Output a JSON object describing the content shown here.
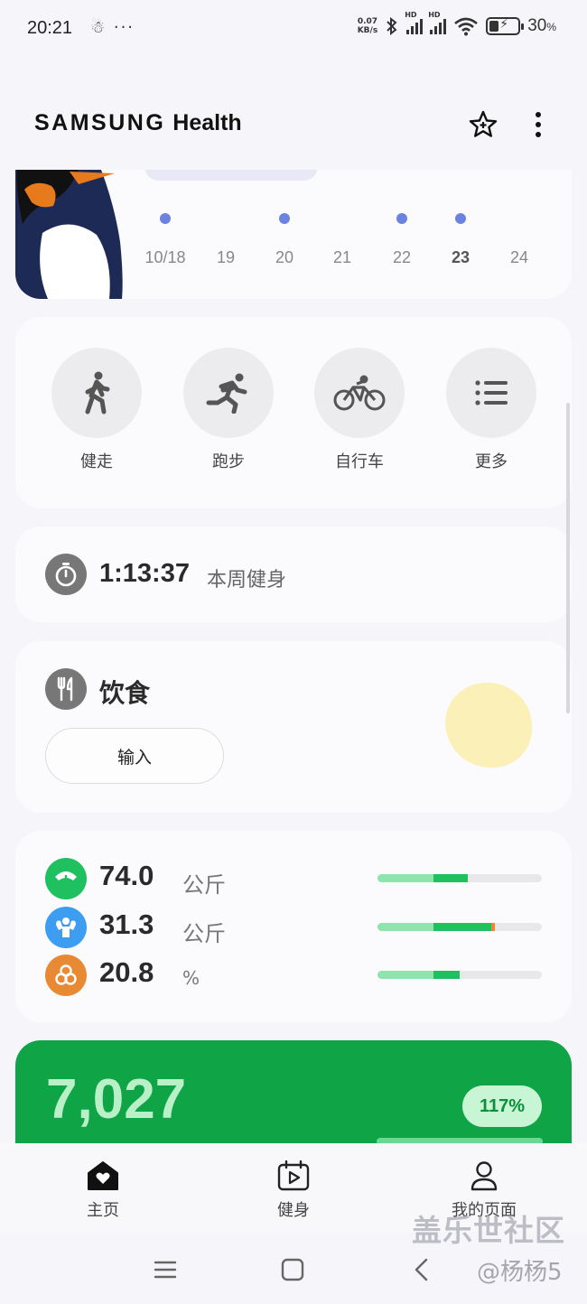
{
  "status_bar": {
    "time": "20:21",
    "left_icons": "☃ ···",
    "net_speed_value": "0.07",
    "net_speed_unit": "KB/s",
    "hd1": "HD",
    "hd2": "HD",
    "battery_percent": "30",
    "battery_symbol": "%"
  },
  "header": {
    "brand_samsung": "SAMSUNG",
    "brand_health": "Health",
    "star_icon": "star-plus-icon",
    "more_icon": "more-vertical-icon"
  },
  "calendar": {
    "days": [
      {
        "label": "10/18",
        "dot": true,
        "bold": false
      },
      {
        "label": "19",
        "dot": false,
        "bold": false
      },
      {
        "label": "20",
        "dot": true,
        "bold": false
      },
      {
        "label": "21",
        "dot": false,
        "bold": false
      },
      {
        "label": "22",
        "dot": true,
        "bold": false
      },
      {
        "label": "23",
        "dot": true,
        "bold": true
      },
      {
        "label": "24",
        "dot": false,
        "bold": false
      }
    ]
  },
  "activities": [
    {
      "label": "健走",
      "icon": "walk-icon"
    },
    {
      "label": "跑步",
      "icon": "run-icon"
    },
    {
      "label": "自行车",
      "icon": "bike-icon"
    },
    {
      "label": "更多",
      "icon": "list-icon"
    }
  ],
  "weekly_workout": {
    "time": "1:13:37",
    "label": "本周健身"
  },
  "food": {
    "title": "饮食",
    "input_label": "输入"
  },
  "body": {
    "metrics": [
      {
        "value": "74.0",
        "unit": "公斤",
        "icon": "scale-icon",
        "color": "#1fc060",
        "fill": 0.55
      },
      {
        "value": "31.3",
        "unit": "公斤",
        "icon": "muscle-icon",
        "color": "#3d9df0",
        "fill": 0.69
      },
      {
        "value": "20.8",
        "unit": "%",
        "icon": "body-fat-icon",
        "color": "#e88a34",
        "fill": 0.5
      }
    ]
  },
  "steps": {
    "value": "7,027",
    "percent": "117%"
  },
  "bottom_nav": [
    {
      "label": "主页",
      "icon": "home-heart-icon"
    },
    {
      "label": "健身",
      "icon": "fitness-calendar-icon"
    },
    {
      "label": "我的页面",
      "icon": "profile-icon"
    }
  ],
  "watermark": {
    "line1": "盖乐世社区",
    "line2": "@杨杨5"
  },
  "colors": {
    "accent_green": "#0fa547",
    "dot_blue": "#6b83e0"
  }
}
